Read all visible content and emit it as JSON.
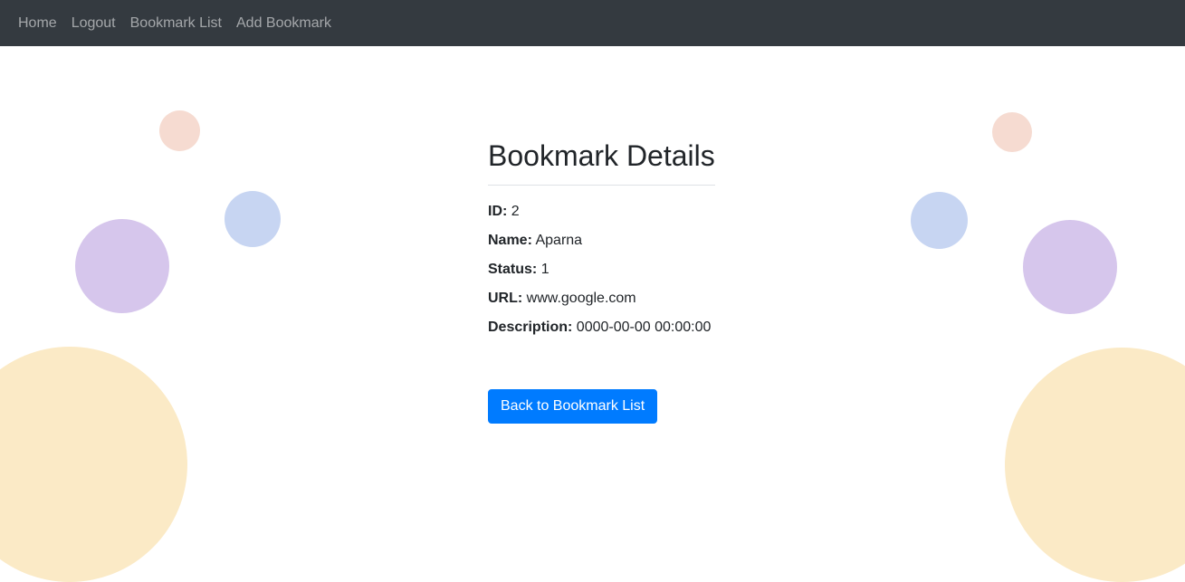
{
  "nav": {
    "items": [
      {
        "label": "Home"
      },
      {
        "label": "Logout"
      },
      {
        "label": "Bookmark List"
      },
      {
        "label": "Add Bookmark"
      }
    ]
  },
  "page": {
    "title": "Bookmark Details"
  },
  "details": {
    "id": {
      "label": "ID:",
      "value": "2"
    },
    "name": {
      "label": "Name:",
      "value": "Aparna"
    },
    "status": {
      "label": "Status:",
      "value": "1"
    },
    "url": {
      "label": "URL:",
      "value": "www.google.com"
    },
    "description": {
      "label": "Description:",
      "value": "0000-00-00 00:00:00"
    }
  },
  "actions": {
    "back_label": "Back to Bookmark List"
  },
  "colors": {
    "navbar": "#343a40",
    "primary": "#007bff",
    "deco_peach": "#f6dbd1",
    "deco_blue": "#c7d5f2",
    "deco_purple": "#d6c6ec",
    "deco_yellow": "#fbeac6"
  }
}
